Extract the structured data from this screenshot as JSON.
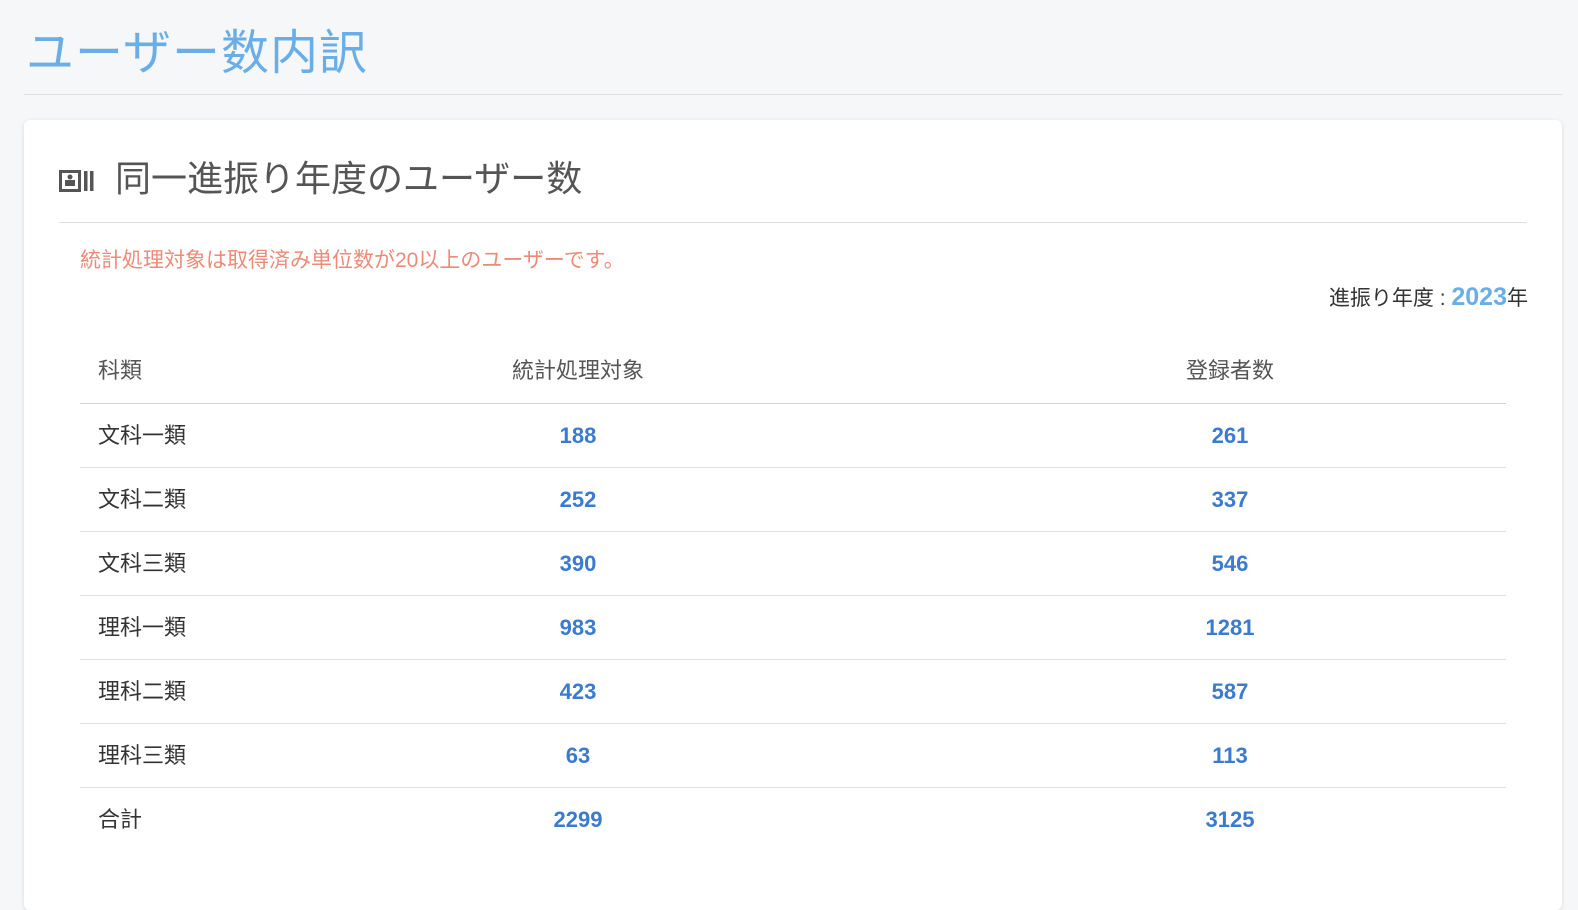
{
  "page": {
    "title": "ユーザー数内訳"
  },
  "card": {
    "icon": "id-card-icon",
    "title": "同一進振り年度のユーザー数",
    "notice": "統計処理対象は取得済み単位数が20以上のユーザーです。",
    "year_label": "進振り年度 : ",
    "year_value": "2023",
    "year_suffix": "年"
  },
  "table": {
    "headers": [
      "科類",
      "統計処理対象",
      "登録者数"
    ],
    "rows": [
      {
        "category": "文科一類",
        "target": "188",
        "registered": "261"
      },
      {
        "category": "文科二類",
        "target": "252",
        "registered": "337"
      },
      {
        "category": "文科三類",
        "target": "390",
        "registered": "546"
      },
      {
        "category": "理科一類",
        "target": "983",
        "registered": "1281"
      },
      {
        "category": "理科二類",
        "target": "423",
        "registered": "587"
      },
      {
        "category": "理科三類",
        "target": "63",
        "registered": "113"
      }
    ],
    "total": {
      "category": "合計",
      "target": "2299",
      "registered": "3125"
    }
  },
  "colors": {
    "title": "#6aaee8",
    "notice": "#ee8a78",
    "number": "#3a7bd0",
    "year": "#6aaee8"
  }
}
